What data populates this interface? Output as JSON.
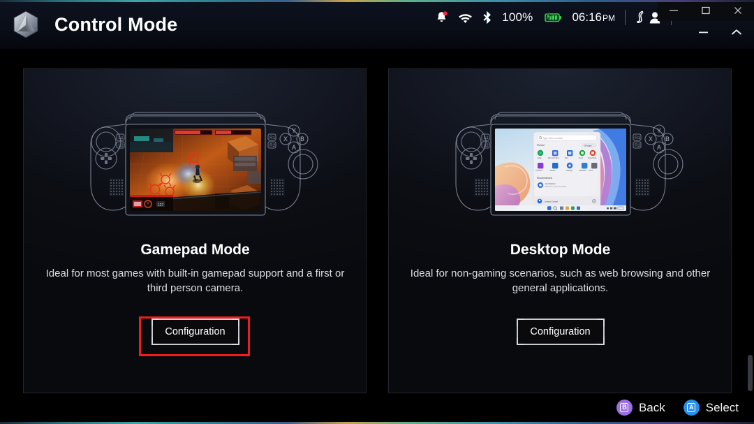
{
  "window": {
    "app_title": "Control Mode",
    "logo_icon": "legion-hexagon-logo-icon",
    "os_controls": [
      {
        "name": "minimize",
        "icon": "minimize-icon",
        "label": "–"
      },
      {
        "name": "maximize",
        "icon": "maximize-icon",
        "label": "□"
      },
      {
        "name": "close",
        "icon": "close-icon",
        "label": "✕"
      }
    ],
    "app_controls": [
      {
        "name": "app-minimize",
        "icon": "minimize-icon",
        "label": "–"
      },
      {
        "name": "app-collapse",
        "icon": "chevron-up-icon",
        "label": "⌃"
      }
    ]
  },
  "status_bar": {
    "notification_icon": "bell-notification-icon",
    "wifi_icon": "wifi-icon",
    "bluetooth_icon": "bluetooth-icon",
    "battery_percent": "100%",
    "battery_icon": "battery-charging-icon",
    "battery_color": "#36d44a",
    "time": "06:16",
    "ampm": "PM",
    "user_icon": "user-profile-icon",
    "account_icon": "account-person-icon"
  },
  "cards": [
    {
      "id": "gamepad-mode",
      "art_icon": "handheld-console-gameplay-art",
      "title": "Gamepad Mode",
      "description": "Ideal for most games with built-in gamepad support and a first or third person camera.",
      "button_label": "Configuration",
      "highlighted": true
    },
    {
      "id": "desktop-mode",
      "art_icon": "handheld-console-desktop-art",
      "title": "Desktop Mode",
      "description": "Ideal for non-gaming scenarios, such as web browsing and other general applications.",
      "button_label": "Configuration",
      "highlighted": false
    }
  ],
  "footer": {
    "hints": [
      {
        "glyph": "B",
        "label": "Back",
        "color": "#9a6fe0",
        "icon": "gamepad-b-button-icon"
      },
      {
        "glyph": "A",
        "label": "Select",
        "color": "#2b8fe8",
        "icon": "gamepad-a-button-icon"
      }
    ]
  },
  "annotation": {
    "color": "#ef1c1c",
    "target": "gamepad-mode-configuration-button"
  }
}
